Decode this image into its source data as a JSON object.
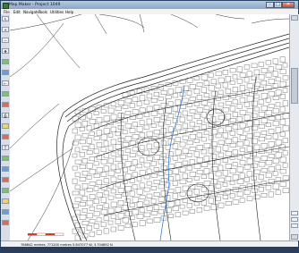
{
  "window": {
    "title": "Map Maker - Project 1049",
    "minimize_glyph": "–",
    "maximize_glyph": "□",
    "close_glyph": "✕"
  },
  "menu": {
    "items": [
      "File",
      "Edit",
      "Navigate",
      "Tools",
      "Utilities",
      "Help"
    ]
  },
  "left_toolbar": {
    "buttons": [
      {
        "icon": "pointer-icon",
        "glyph": "↖"
      },
      {
        "icon": "zoom-in-icon",
        "glyph": "+"
      },
      {
        "icon": "zoom-out-icon",
        "glyph": "−"
      },
      {
        "icon": "pan-icon",
        "glyph": "✥"
      },
      {
        "icon": "layer-green-icon",
        "glyph": ""
      },
      {
        "icon": "layer-blue-icon",
        "glyph": ""
      },
      {
        "icon": "ruler-icon",
        "glyph": "⊢"
      },
      {
        "icon": "layer-green-icon",
        "glyph": ""
      },
      {
        "icon": "layer-red-icon",
        "glyph": ""
      },
      {
        "icon": "print-icon",
        "glyph": "⎙"
      },
      {
        "icon": "layer-yellow-icon",
        "glyph": ""
      },
      {
        "icon": "layer-red-icon",
        "glyph": ""
      },
      {
        "icon": "text-icon",
        "glyph": "T"
      },
      {
        "icon": "layer-green-icon",
        "glyph": ""
      },
      {
        "icon": "layer-blue-icon",
        "glyph": ""
      },
      {
        "icon": "layer-red-icon",
        "glyph": ""
      },
      {
        "icon": "layer-green-icon",
        "glyph": ""
      },
      {
        "icon": "layer-yellow-icon",
        "glyph": ""
      },
      {
        "icon": "layer-blue-icon",
        "glyph": ""
      },
      {
        "icon": "layer-red-icon",
        "glyph": ""
      }
    ]
  },
  "status": {
    "text": "786842 metres, 7?1200 metres     5.847077 W, 5.?04892 N"
  },
  "colors": {
    "title_gradient": "#8aa5c8",
    "map_background": "#ffffff",
    "river": "#3c7bd6",
    "road": "#222222",
    "scale_red": "#d23a2a"
  }
}
